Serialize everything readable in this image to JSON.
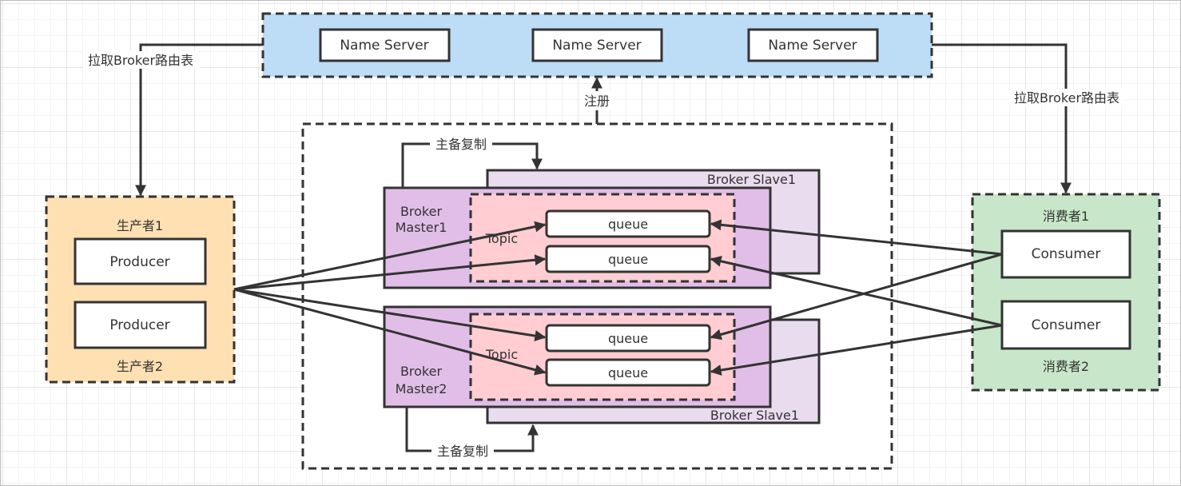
{
  "colors": {
    "name_server_group": "#bddcf5",
    "producer_group": "#ffe0b2",
    "consumer_group": "#c8e6c9",
    "broker_master": "#e1bee7",
    "broker_slave": "#eadcef",
    "topic": "#ffcdd2",
    "line": "#333333"
  },
  "name_servers": [
    {
      "label": "Name Server"
    },
    {
      "label": "Name Server"
    },
    {
      "label": "Name Server"
    }
  ],
  "edges": {
    "producer_route": "拉取Broker路由表",
    "consumer_route": "拉取Broker路由表",
    "register": "注册",
    "replication_top": "主备复制",
    "replication_bottom": "主备复制"
  },
  "producer_group": {
    "title_top": "生产者1",
    "title_bottom": "生产者2",
    "producers": [
      {
        "label": "Producer"
      },
      {
        "label": "Producer"
      }
    ]
  },
  "consumer_group": {
    "title_top": "消费者1",
    "title_bottom": "消费者2",
    "consumers": [
      {
        "label": "Consumer"
      },
      {
        "label": "Consumer"
      }
    ]
  },
  "brokers": [
    {
      "master_line1": "Broker",
      "master_line2": "Master1",
      "slave": "Broker Slave1",
      "topic": "Topic",
      "queues": [
        "queue",
        "queue"
      ]
    },
    {
      "master_line1": "Broker",
      "master_line2": "Master2",
      "slave": "Broker Slave1",
      "topic": "Topic",
      "queues": [
        "queue",
        "queue"
      ]
    }
  ]
}
